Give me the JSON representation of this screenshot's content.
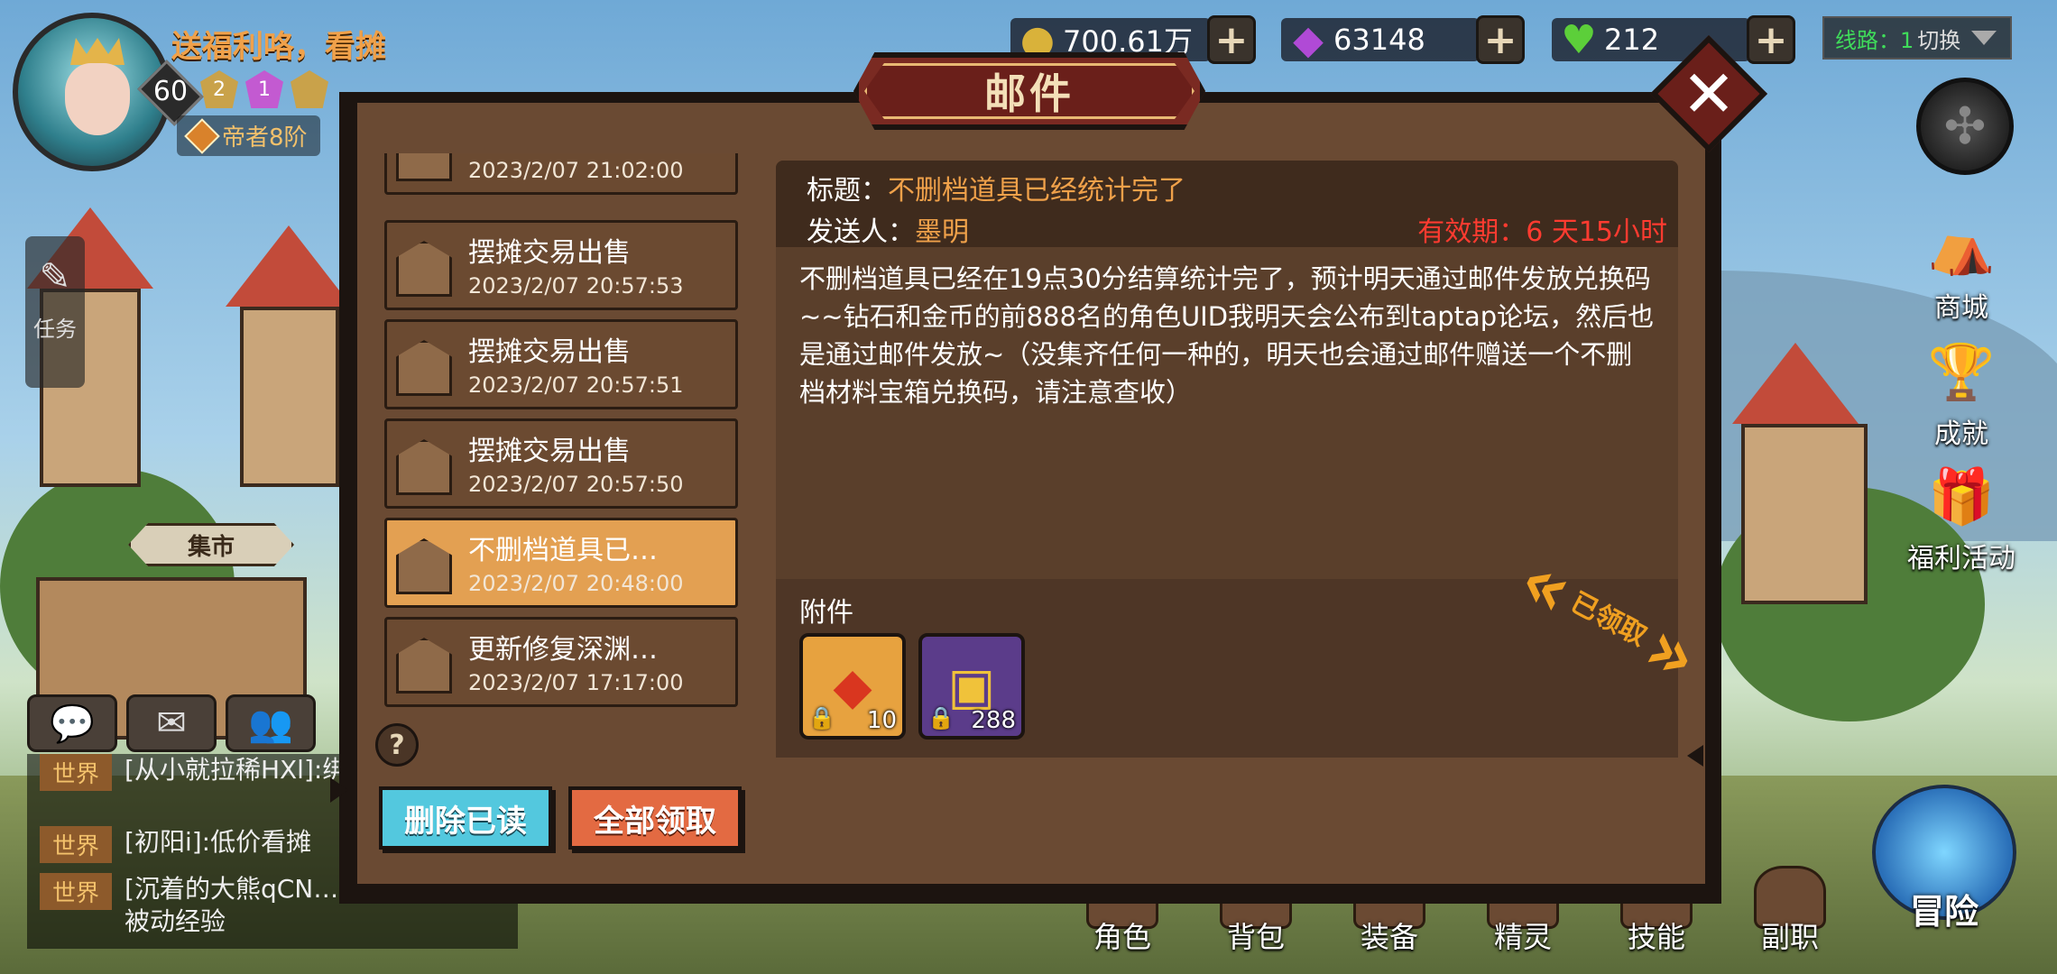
{
  "player": {
    "name": "送福利咯，看摊",
    "level": "60",
    "vip_badges": [
      "2",
      "1"
    ],
    "rank": "帝者8阶"
  },
  "currencies": [
    {
      "icon": "gold-coin-icon",
      "glyph": "●",
      "color": "#d9b23a",
      "value": "700.61万"
    },
    {
      "icon": "purple-gem-icon",
      "glyph": "◆",
      "color": "#b04ad6",
      "value": "63148"
    },
    {
      "icon": "green-heart-icon",
      "glyph": "♥",
      "color": "#5ccf3a",
      "value": "212"
    }
  ],
  "line_switch": {
    "line_label": "线路：1",
    "switch_label": "切换"
  },
  "side_menu": [
    {
      "name": "shop",
      "label": "商城",
      "glyph": "⛺",
      "color": "#c94a3a"
    },
    {
      "name": "achievement",
      "label": "成就",
      "glyph": "🏆",
      "color": "#d9a23a"
    },
    {
      "name": "welfare",
      "label": "福利活动",
      "glyph": "🎁",
      "color": "#a86ad6"
    }
  ],
  "task_button": {
    "label": "任务"
  },
  "market_sign": "集市",
  "chat": {
    "tabs": [
      {
        "name": "chat-bubble-icon",
        "glyph": "💬"
      },
      {
        "name": "mail-icon",
        "glyph": "✉"
      },
      {
        "name": "friends-icon",
        "glyph": "👥"
      }
    ],
    "lines": [
      {
        "channel": "世界",
        "text": "[从小就拉稀HXl]:绑粉超低价"
      },
      {
        "channel": "世界",
        "text": "[初阳i]:低价看摊"
      },
      {
        "channel": "世界",
        "text": "[沉着的大熊qCN…]:冰雹寒冰粉被动经验"
      }
    ]
  },
  "bottom_nav": [
    {
      "name": "character",
      "label": "角色"
    },
    {
      "name": "bag",
      "label": "背包"
    },
    {
      "name": "equipment",
      "label": "装备"
    },
    {
      "name": "spirit",
      "label": "精灵"
    },
    {
      "name": "skill",
      "label": "技能"
    },
    {
      "name": "subclass",
      "label": "副职"
    }
  ],
  "adventure_label": "冒险",
  "mail": {
    "title": "邮件",
    "list": [
      {
        "subject": "",
        "date": "2023/2/07 21:02:00",
        "active": false
      },
      {
        "subject": "摆摊交易出售",
        "date": "2023/2/07 20:57:53",
        "active": false
      },
      {
        "subject": "摆摊交易出售",
        "date": "2023/2/07 20:57:51",
        "active": false
      },
      {
        "subject": "摆摊交易出售",
        "date": "2023/2/07 20:57:50",
        "active": false
      },
      {
        "subject": "不删档道具已…",
        "date": "2023/2/07 20:48:00",
        "active": true
      },
      {
        "subject": "更新修复深渊…",
        "date": "2023/2/07 17:17:00",
        "active": false
      }
    ],
    "delete_read_label": "删除已读",
    "claim_all_label": "全部领取",
    "detail": {
      "title_label": "标题：",
      "title": "不删档道具已经统计完了",
      "sender_label": "发送人：",
      "sender": "墨明",
      "expiry": "有效期：6 天15小时",
      "body": "不删档道具已经在19点30分结算统计完了，预计明天通过邮件发放兑换码~~钻石和金币的前888名的角色UID我明天会公布到taptap论坛，然后也是通过邮件发放~（没集齐任何一种的，明天也会通过邮件赠送一个不删档材料宝箱兑换码，请注意查收）",
      "attachments_label": "附件",
      "attachments": [
        {
          "name": "red-crystal-item",
          "count": "10"
        },
        {
          "name": "gold-chest-item",
          "count": "288"
        }
      ],
      "claimed_label": "已领取"
    }
  }
}
